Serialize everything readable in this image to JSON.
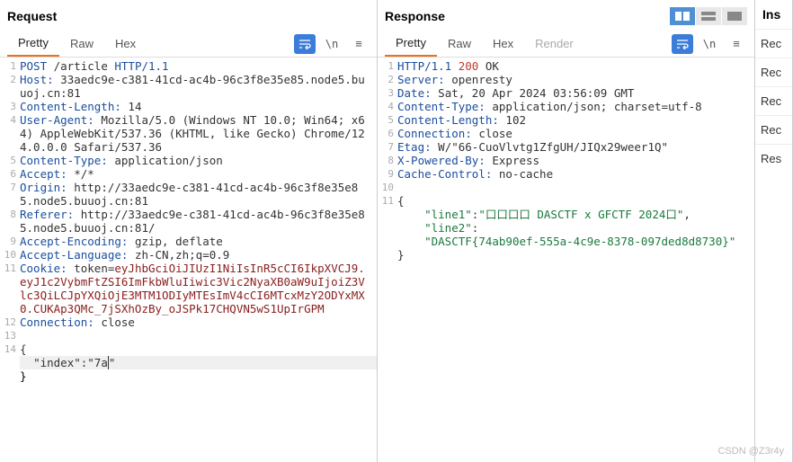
{
  "request": {
    "title": "Request",
    "tabs": {
      "pretty": "Pretty",
      "raw": "Raw",
      "hex": "Hex"
    },
    "lines": [
      {
        "n": 1,
        "segs": [
          [
            "kw",
            "POST"
          ],
          [
            "plain",
            " /article "
          ],
          [
            "kw",
            "HTTP/1.1"
          ]
        ]
      },
      {
        "n": 2,
        "segs": [
          [
            "kw",
            "Host:"
          ],
          [
            "plain",
            " 33aedc9e-c381-41cd-ac4b-96c3f8e35e85.node5.buuoj.cn:81"
          ]
        ]
      },
      {
        "n": 3,
        "segs": [
          [
            "kw",
            "Content-Length:"
          ],
          [
            "plain",
            " 14"
          ]
        ]
      },
      {
        "n": 4,
        "segs": [
          [
            "kw",
            "User-Agent:"
          ],
          [
            "plain",
            " Mozilla/5.0 (Windows NT 10.0; Win64; x64) AppleWebKit/537.36 (KHTML, like Gecko) Chrome/124.0.0.0 Safari/537.36"
          ]
        ]
      },
      {
        "n": 5,
        "segs": [
          [
            "kw",
            "Content-Type:"
          ],
          [
            "plain",
            " application/json"
          ]
        ]
      },
      {
        "n": 6,
        "segs": [
          [
            "kw",
            "Accept:"
          ],
          [
            "plain",
            " */*"
          ]
        ]
      },
      {
        "n": 7,
        "segs": [
          [
            "kw",
            "Origin:"
          ],
          [
            "plain",
            " http://33aedc9e-c381-41cd-ac4b-96c3f8e35e85.node5.buuoj.cn:81"
          ]
        ]
      },
      {
        "n": 8,
        "segs": [
          [
            "kw",
            "Referer:"
          ],
          [
            "plain",
            " http://33aedc9e-c381-41cd-ac4b-96c3f8e35e85.node5.buuoj.cn:81/"
          ]
        ]
      },
      {
        "n": 9,
        "segs": [
          [
            "kw",
            "Accept-Encoding:"
          ],
          [
            "plain",
            " gzip, deflate"
          ]
        ]
      },
      {
        "n": 10,
        "segs": [
          [
            "kw",
            "Accept-Language:"
          ],
          [
            "plain",
            " zh-CN,zh;q=0.9"
          ]
        ]
      },
      {
        "n": 11,
        "segs": [
          [
            "kw",
            "Cookie:"
          ],
          [
            "plain",
            " token="
          ],
          [
            "tok",
            "eyJhbGciOiJIUzI1NiIsInR5cCI6IkpXVCJ9.eyJ1c2VybmFtZSI6ImFkbWluIiwic3Vic2NyaXB0aW9uIjoiZ3Vlc3QiLCJpYXQiOjE3MTM1ODIyMTEsImV4cCI6MTcxMzY2ODYxMX0.CUKAp3QMc_7jSXhOzBy_oJSPk17CHQVN5wS1UpIrGPM"
          ]
        ]
      },
      {
        "n": 12,
        "segs": [
          [
            "kw",
            "Connection:"
          ],
          [
            "plain",
            " close"
          ]
        ]
      },
      {
        "n": 13,
        "segs": [
          [
            "plain",
            ""
          ]
        ]
      },
      {
        "n": 14,
        "segs": [
          [
            "plain",
            "{"
          ]
        ]
      }
    ],
    "editLine": {
      "n": "",
      "prefix": "  \"index\":\"7a",
      "suffix": "\""
    },
    "closeLine": "}"
  },
  "response": {
    "title": "Response",
    "tabs": {
      "pretty": "Pretty",
      "raw": "Raw",
      "hex": "Hex",
      "render": "Render"
    },
    "lines": [
      {
        "n": 1,
        "segs": [
          [
            "kw",
            "HTTP/1.1"
          ],
          [
            "plain",
            " "
          ],
          [
            "num",
            "200"
          ],
          [
            "plain",
            " OK"
          ]
        ]
      },
      {
        "n": 2,
        "segs": [
          [
            "kw",
            "Server:"
          ],
          [
            "plain",
            " openresty"
          ]
        ]
      },
      {
        "n": 3,
        "segs": [
          [
            "kw",
            "Date:"
          ],
          [
            "plain",
            " Sat, 20 Apr 2024 03:56:09 GMT"
          ]
        ]
      },
      {
        "n": 4,
        "segs": [
          [
            "kw",
            "Content-Type:"
          ],
          [
            "plain",
            " application/json; charset=utf-8"
          ]
        ]
      },
      {
        "n": 5,
        "segs": [
          [
            "kw",
            "Content-Length:"
          ],
          [
            "plain",
            " 102"
          ]
        ]
      },
      {
        "n": 6,
        "segs": [
          [
            "kw",
            "Connection:"
          ],
          [
            "plain",
            " close"
          ]
        ]
      },
      {
        "n": 7,
        "segs": [
          [
            "kw",
            "Etag:"
          ],
          [
            "plain",
            " W/\"66-CuoVlvtg1ZfgUH/JIQx29weer1Q\""
          ]
        ]
      },
      {
        "n": 8,
        "segs": [
          [
            "kw",
            "X-Powered-By:"
          ],
          [
            "plain",
            " Express"
          ]
        ]
      },
      {
        "n": 9,
        "segs": [
          [
            "kw",
            "Cache-Control:"
          ],
          [
            "plain",
            " no-cache"
          ]
        ]
      },
      {
        "n": 10,
        "segs": [
          [
            "plain",
            ""
          ]
        ]
      },
      {
        "n": 11,
        "segs": [
          [
            "plain",
            "{"
          ]
        ]
      },
      {
        "n": "",
        "segs": [
          [
            "plain",
            "    "
          ],
          [
            "str",
            "\"line1\""
          ],
          [
            "plain",
            ":"
          ],
          [
            "str",
            "\"口口口口 DASCTF x GFCTF 2024口\""
          ],
          [
            "plain",
            ","
          ]
        ]
      },
      {
        "n": "",
        "segs": [
          [
            "plain",
            "    "
          ],
          [
            "str",
            "\"line2\""
          ],
          [
            "plain",
            ":"
          ]
        ]
      },
      {
        "n": "",
        "segs": [
          [
            "plain",
            "    "
          ],
          [
            "str",
            "\"DASCTF{74ab90ef-555a-4c9e-8378-097ded8d8730}\""
          ]
        ]
      },
      {
        "n": "",
        "segs": [
          [
            "plain",
            "}"
          ]
        ]
      }
    ]
  },
  "inspector": {
    "title": "Ins",
    "rows": [
      "Rec",
      "Rec",
      "Rec",
      "Rec",
      "Res"
    ]
  },
  "icons": {
    "newline": "\\n",
    "hamburger": "≡",
    "wrap": "⇆"
  },
  "watermark": "CSDN @Z3r4y"
}
